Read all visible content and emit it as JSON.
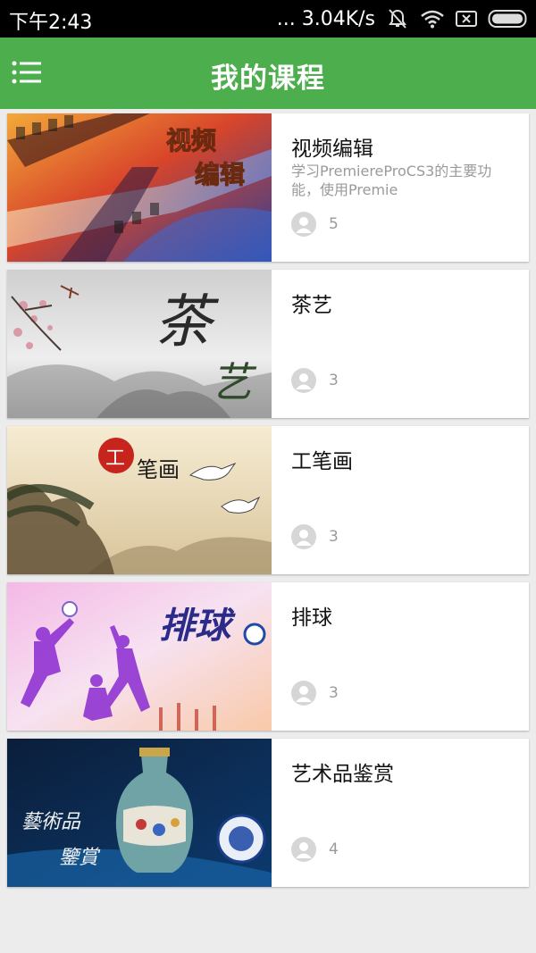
{
  "status_bar": {
    "time": "下午2:43",
    "network_speed": "... 3.04K/s",
    "icons": [
      "mute-icon",
      "wifi-icon",
      "sim-off-icon",
      "battery-icon"
    ]
  },
  "header": {
    "title": "我的课程",
    "menu_icon": "menu-icon",
    "color": "#4cae4c"
  },
  "courses": [
    {
      "title": "视频编辑",
      "description": "学习PremiereProCS3的主要功能，使用Premie",
      "learners": "5",
      "thumbnail_text": [
        "视频",
        "编辑"
      ]
    },
    {
      "title": "茶艺",
      "description": "",
      "learners": "3",
      "thumbnail_text": [
        "茶",
        "艺"
      ]
    },
    {
      "title": "工笔画",
      "description": "",
      "learners": "3",
      "thumbnail_text": [
        "工",
        "笔画"
      ]
    },
    {
      "title": "排球",
      "description": "",
      "learners": "3",
      "thumbnail_text": [
        "排球"
      ]
    },
    {
      "title": "艺术品鉴赏",
      "description": "",
      "learners": "4",
      "thumbnail_text": [
        "藝術品",
        "鑒賞"
      ]
    }
  ]
}
